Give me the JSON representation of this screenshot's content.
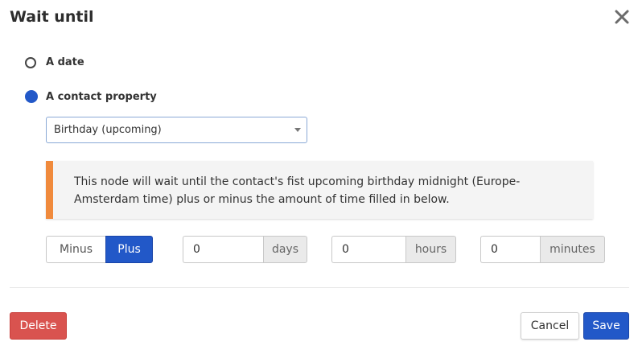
{
  "dialog": {
    "title": "Wait until",
    "close_icon": "close-icon"
  },
  "options": {
    "date_label": "A date",
    "contact_property_label": "A contact property",
    "selected": "contact_property"
  },
  "property_select": {
    "value": "Birthday (upcoming)"
  },
  "notice": {
    "accent_color": "#f08a3c",
    "text": "This node will wait until the contact's fist upcoming birthday midnight (Europe-Amsterdam time) plus or minus the amount of time filled in below."
  },
  "offset": {
    "minus_label": "Minus",
    "plus_label": "Plus",
    "active": "Plus",
    "days_value": "0",
    "days_label": "days",
    "hours_value": "0",
    "hours_label": "hours",
    "minutes_value": "0",
    "minutes_label": "minutes"
  },
  "footer": {
    "delete_label": "Delete",
    "cancel_label": "Cancel",
    "save_label": "Save"
  },
  "colors": {
    "primary": "#2258c8",
    "danger": "#d9534f"
  }
}
